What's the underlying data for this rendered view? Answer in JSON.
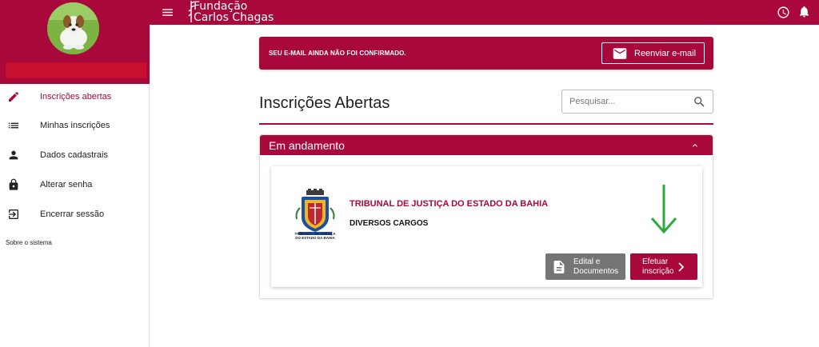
{
  "brand": {
    "name_line1": "Fundação",
    "name_line2": "Carlos Chagas",
    "primary_color": "#a8093a"
  },
  "sidebar": {
    "items": [
      {
        "label": "Inscrições abertas",
        "icon": "pencil-icon",
        "active": true
      },
      {
        "label": "Minhas inscrições",
        "icon": "list-icon",
        "active": false
      },
      {
        "label": "Dados cadastrais",
        "icon": "person-icon",
        "active": false
      },
      {
        "label": "Alterar senha",
        "icon": "lock-icon",
        "active": false
      },
      {
        "label": "Encerrar sessão",
        "icon": "logout-icon",
        "active": false
      }
    ],
    "about": "Sobre o sistema"
  },
  "topbar": {
    "icons": [
      "menu-icon",
      "clock-icon",
      "bell-icon"
    ]
  },
  "alert": {
    "message": "SEU E-MAIL AINDA NÃO FOI CONFIRMADO.",
    "button_label": "Reenviar e-mail",
    "button_icon": "envelope-icon"
  },
  "main": {
    "title": "Inscrições Abertas",
    "search": {
      "placeholder": "Pesquisar...",
      "value": ""
    }
  },
  "panel": {
    "title": "Em andamento",
    "card": {
      "crest_caption_line1": "TRIBUNAL DE JUSTIÇA",
      "crest_caption_line2": "DO ESTADO DA BAHIA",
      "organization": "TRIBUNAL DE JUSTIÇA DO ESTADO DA BAHIA",
      "roles": "DIVERSOS CARGOS",
      "docs_button": {
        "line1": "Edital e",
        "line2": "Documentos"
      },
      "enroll_button": {
        "line1": "Efetuar",
        "line2": "inscrição"
      },
      "arrow_color": "#2eaa3c"
    }
  }
}
